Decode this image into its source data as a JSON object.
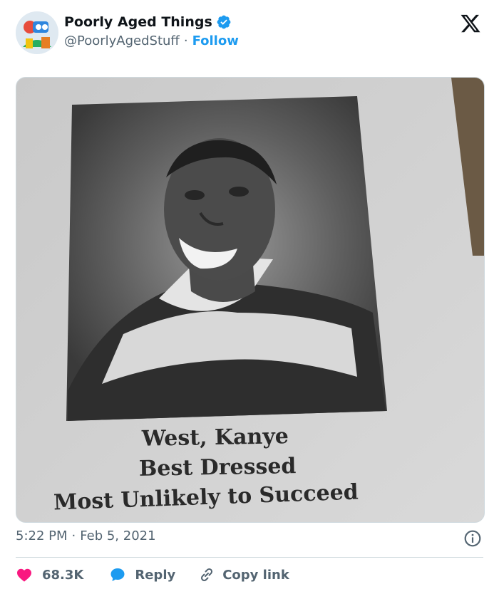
{
  "author": {
    "display_name": "Poorly Aged Things",
    "handle": "@PoorlyAgedStuff",
    "follow_label": "Follow",
    "separator": "·",
    "verified": true
  },
  "media": {
    "caption": [
      "West, Kanye",
      "Best Dressed",
      "Most Unlikely to Succeed"
    ]
  },
  "meta": {
    "time": "5:22 PM",
    "separator": "·",
    "date": "Feb 5, 2021"
  },
  "actions": {
    "like_count": "68.3K",
    "reply_label": "Reply",
    "copy_link_label": "Copy link"
  },
  "icons": {
    "brand": "x-logo-icon",
    "verified": "verified-badge-icon",
    "info": "info-icon",
    "like": "heart-icon",
    "reply": "reply-bubble-icon",
    "copy": "link-icon"
  },
  "colors": {
    "accent": "#1d9bf0",
    "like": "#f91880",
    "muted": "#536471",
    "text": "#0f1419"
  }
}
